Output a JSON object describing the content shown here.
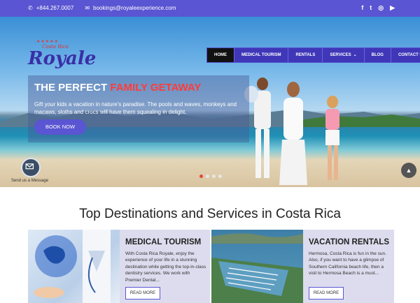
{
  "topbar": {
    "phone": "+844.267.0007",
    "email": "bookings@royaleexperience.com",
    "social": [
      {
        "icon": "facebook-icon",
        "glyph": "f"
      },
      {
        "icon": "twitter-icon",
        "glyph": "t"
      },
      {
        "icon": "instagram-icon",
        "glyph": "◎"
      },
      {
        "icon": "youtube-icon",
        "glyph": "▶"
      }
    ]
  },
  "logo": {
    "stars": "★★★★★",
    "costa": "Costa Rica",
    "royale": "Royale"
  },
  "nav": {
    "home": "HOME",
    "medical": "MEDICAL TOURISM",
    "rentals": "RENTALS",
    "services": "SERVICES",
    "blog": "BLOG",
    "contact": "CONTACT US"
  },
  "hero": {
    "title_white": "THE PERFECT",
    "title_red": "FAMILY GETAWAY",
    "text": "Gift your kids a vacation in nature's paradise. The pools and waves, monkeys and macaws, sloths and crocs will have them squealing in delight.",
    "button": "BOOK NOW",
    "slide_count": 4,
    "active_slide": 1
  },
  "chat": {
    "label": "Send us a Message"
  },
  "section": {
    "title": "Top Destinations and Services in Costa Rica"
  },
  "cards": [
    {
      "title": "MEDICAL TOURISM",
      "text": "With Costa Rica Royale, enjoy the experience of your life in a stunning destination while getting the top-in-class dentistry services. We work with Premier Dental...",
      "button": "READ MORE"
    },
    {
      "title": "VACATION RENTALS",
      "text": "Hermosa, Costa Rica is fun in the sun. Also, if you want to have a glimpse of Southern California beach life, then a visit to Hermosa Beach is a must...",
      "button": "READ MORE"
    }
  ],
  "colors": {
    "brand": "#5a55d2",
    "accent_red": "#ff3b3b",
    "nav_bg": "#3f37b8"
  }
}
